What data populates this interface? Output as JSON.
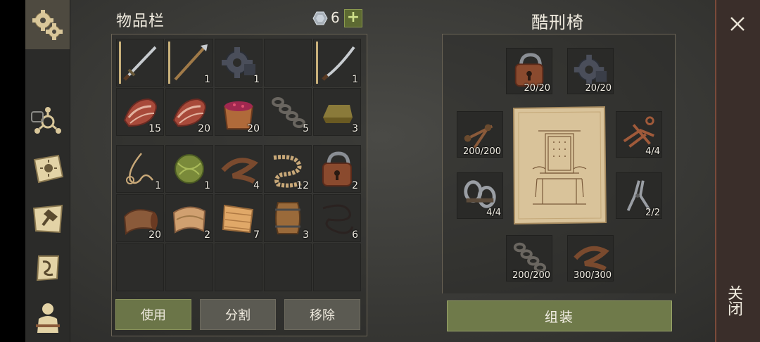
{
  "sidebar": {
    "items": [
      {
        "icon": "gears-icon",
        "active": true
      },
      {
        "icon": "network-icon"
      },
      {
        "icon": "sun-book-icon"
      },
      {
        "icon": "crafting-map-icon"
      },
      {
        "icon": "quest-scroll-icon"
      },
      {
        "icon": "character-icon"
      }
    ]
  },
  "inventory": {
    "title": "物品栏",
    "currency_count": "6",
    "add_label": "+",
    "rows_top": [
      [
        {
          "icon": "sword-icon",
          "count": ""
        },
        {
          "icon": "spear-icon",
          "count": "1",
          "badge": "dagger"
        },
        {
          "icon": "gear-part-icon",
          "count": "1"
        },
        {
          "icon": "",
          "count": ""
        },
        {
          "icon": "sabre-icon",
          "count": "1",
          "badge": "dagger"
        }
      ],
      [
        {
          "icon": "raw-meat-icon",
          "count": "15"
        },
        {
          "icon": "raw-meat-icon",
          "count": "20"
        },
        {
          "icon": "berry-bucket-icon",
          "count": "20"
        },
        {
          "icon": "chain-icon",
          "count": "5"
        },
        {
          "icon": "ingot-icon",
          "count": "3"
        }
      ]
    ],
    "rows_bottom": [
      [
        {
          "icon": "rope-coil-icon",
          "count": "1"
        },
        {
          "icon": "fiber-ball-icon",
          "count": "1"
        },
        {
          "icon": "leather-strip-icon",
          "count": "4"
        },
        {
          "icon": "thick-rope-icon",
          "count": "12"
        },
        {
          "icon": "padlock-icon",
          "count": "2"
        }
      ],
      [
        {
          "icon": "leather-roll-icon",
          "count": "20"
        },
        {
          "icon": "cloth-icon",
          "count": "2"
        },
        {
          "icon": "fabric-icon",
          "count": "7"
        },
        {
          "icon": "barrel-icon",
          "count": "3"
        },
        {
          "icon": "thread-icon",
          "count": "6"
        }
      ],
      [
        {
          "icon": "",
          "count": ""
        },
        {
          "icon": "",
          "count": ""
        },
        {
          "icon": "",
          "count": ""
        },
        {
          "icon": "",
          "count": ""
        },
        {
          "icon": "",
          "count": ""
        }
      ]
    ],
    "buttons": {
      "use": "使用",
      "split": "分割",
      "remove": "移除"
    }
  },
  "recipe": {
    "title": "酷刑椅",
    "ingredients": [
      {
        "icon": "padlock-icon",
        "count": "20/20"
      },
      {
        "icon": "gear-part-icon",
        "count": "20/20"
      },
      {
        "icon": "nails-icon",
        "count": "200/200"
      },
      {
        "icon": "rack-frame-icon",
        "count": "4/4"
      },
      {
        "icon": "shackles-icon",
        "count": "4/4"
      },
      {
        "icon": "pliers-icon",
        "count": "2/2"
      },
      {
        "icon": "chain-icon",
        "count": "200/200"
      },
      {
        "icon": "leather-strip-icon",
        "count": "300/300"
      }
    ],
    "assemble_label": "组装"
  },
  "close": {
    "label": "关闭"
  }
}
